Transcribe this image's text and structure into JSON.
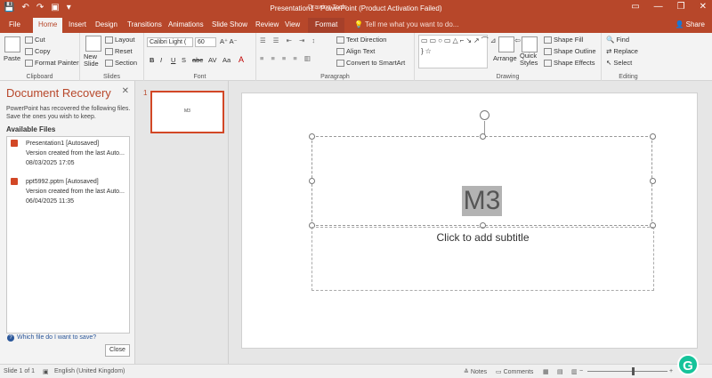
{
  "titlebar": {
    "title": "Presentation1  -  PowerPoint (Product Activation Failed)",
    "context_label": "Drawing Tools",
    "qat_icons": [
      "save-icon",
      "undo-icon",
      "redo-icon",
      "present-icon",
      "customize-icon"
    ],
    "qat_glyphs": [
      "💾",
      "↶",
      "↷",
      "▣",
      "▾"
    ],
    "window_glyphs": [
      "▭",
      "—",
      "❐",
      "✕"
    ]
  },
  "tabs": [
    {
      "label": "File"
    },
    {
      "label": "Home"
    },
    {
      "label": "Insert"
    },
    {
      "label": "Design"
    },
    {
      "label": "Transitions"
    },
    {
      "label": "Animations"
    },
    {
      "label": "Slide Show"
    },
    {
      "label": "Review"
    },
    {
      "label": "View"
    },
    {
      "label": "Format"
    }
  ],
  "tell_me": "Tell me what you want to do...",
  "share": "Share",
  "ribbon": {
    "clipboard": {
      "paste": "Paste",
      "cut": "Cut",
      "copy": "Copy",
      "format_painter": "Format Painter",
      "label": "Clipboard"
    },
    "slides": {
      "new_slide": "New Slide",
      "layout": "Layout",
      "reset": "Reset",
      "section": "Section",
      "label": "Slides"
    },
    "font": {
      "name": "Calibri Light (",
      "size": "60",
      "bold": "B",
      "italic": "I",
      "underline": "U",
      "strike": "S",
      "abc": "abc",
      "av": "AV",
      "aa": "Aa",
      "fontcolor": "A",
      "label": "Font"
    },
    "paragraph": {
      "text_direction": "Text Direction",
      "align_text": "Align Text",
      "convert_smartart": "Convert to SmartArt",
      "label": "Paragraph"
    },
    "drawing": {
      "shapes_glyphs": "▭▭○▭△⌐↘↗⌒⊿⇔⇒⇦⇧{ }☆",
      "arrange": "Arrange",
      "quick_styles": "Quick Styles",
      "shape_fill": "Shape Fill",
      "shape_outline": "Shape Outline",
      "shape_effects": "Shape Effects",
      "label": "Drawing"
    },
    "editing": {
      "find": "Find",
      "replace": "Replace",
      "select": "Select",
      "label": "Editing"
    }
  },
  "recovery": {
    "title": "Document Recovery",
    "description": "PowerPoint has recovered the following files. Save the ones you wish to keep.",
    "available_heading": "Available Files",
    "files": [
      {
        "name": "Presentation1  [Autosaved]",
        "desc": "Version created from the last Auto...",
        "date": "08/03/2025 17:05"
      },
      {
        "name": "ppt5992.pptm  [Autosaved]",
        "desc": "Version created from the last Auto...",
        "date": "06/04/2025 11:35"
      }
    ],
    "help_link": "Which file do I want to save?",
    "close_button": "Close"
  },
  "thumbnail": {
    "number": "1",
    "text": "M3"
  },
  "slide": {
    "title": "M3",
    "subtitle": "Click to add subtitle"
  },
  "status": {
    "slide_count": "Slide 1 of 1",
    "language": "English (United Kingdom)",
    "notes": "Notes",
    "comments": "Comments"
  },
  "accent_color": "#b7472a"
}
